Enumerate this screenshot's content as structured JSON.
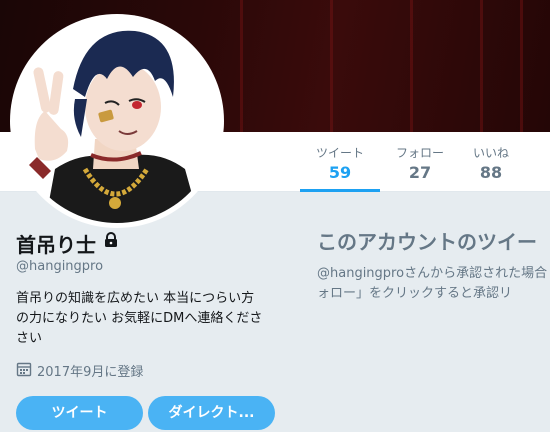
{
  "profile": {
    "display_name": "首吊り士",
    "handle": "@hangingpro",
    "bio_lines": [
      "首吊りの知識を広めたい 本当につらい方",
      "の力になりたい お気軽にDMへ連絡くださ",
      "さい"
    ],
    "joined": "2017年9月に登録"
  },
  "stats": [
    {
      "label": "ツイート",
      "value": "59",
      "active": true
    },
    {
      "label": "フォロー",
      "value": "27",
      "active": false
    },
    {
      "label": "いいね",
      "value": "88",
      "active": false
    }
  ],
  "actions": {
    "tweet_label": "ツイート",
    "dm_label": "ダイレクト..."
  },
  "protected": {
    "title": "このアカウントのツイー",
    "desc_lines": [
      "@hangingproさんから承認された場合",
      "ォロー」をクリックすると承認リ"
    ]
  },
  "colors": {
    "accent": "#1da1f2",
    "button": "#4ab3f4",
    "banner": "#2a0808"
  }
}
